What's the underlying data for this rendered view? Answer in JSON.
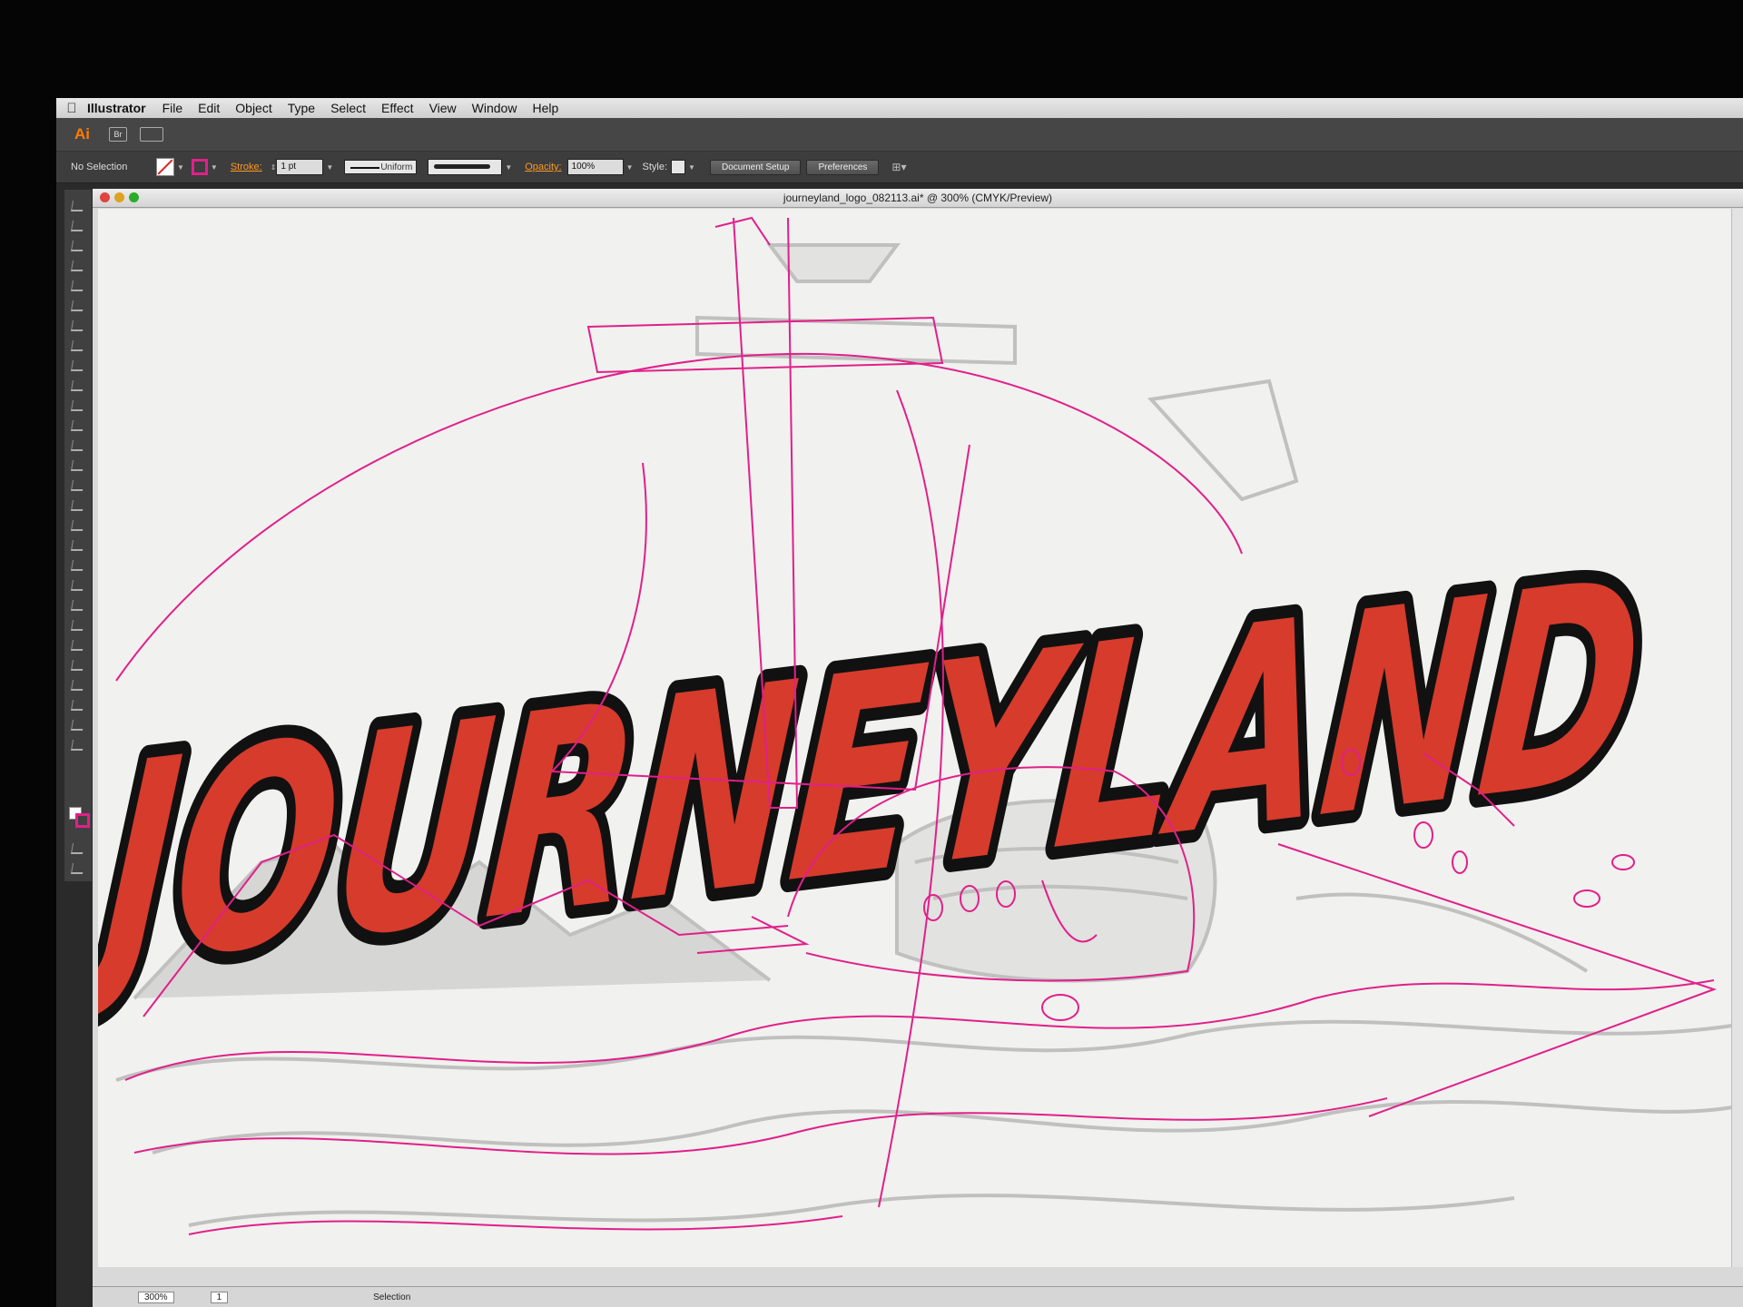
{
  "menubar": {
    "app_name": "Illustrator",
    "items": [
      "File",
      "Edit",
      "Object",
      "Type",
      "Select",
      "Effect",
      "View",
      "Window",
      "Help"
    ]
  },
  "appbar": {
    "logo": "Ai",
    "bridge_label": "Br"
  },
  "control_bar": {
    "selection_status": "No Selection",
    "stroke_label": "Stroke:",
    "stroke_weight": "1 pt",
    "profile": "Uniform",
    "opacity_label": "Opacity:",
    "opacity_value": "100%",
    "style_label": "Style:",
    "document_setup_label": "Document Setup",
    "preferences_label": "Preferences"
  },
  "document": {
    "title": "journeyland_logo_082113.ai* @ 300% (CMYK/Preview)"
  },
  "artwork": {
    "logo_text": "JOURNEYLAND",
    "colors": {
      "letter_fill": "#d63b2c",
      "letter_outline": "#111111",
      "guide": "#e0208a",
      "sketch": "#b8b8b8"
    }
  },
  "statusbar": {
    "zoom": "300%",
    "artboard": "1",
    "tool_status": "Selection"
  }
}
